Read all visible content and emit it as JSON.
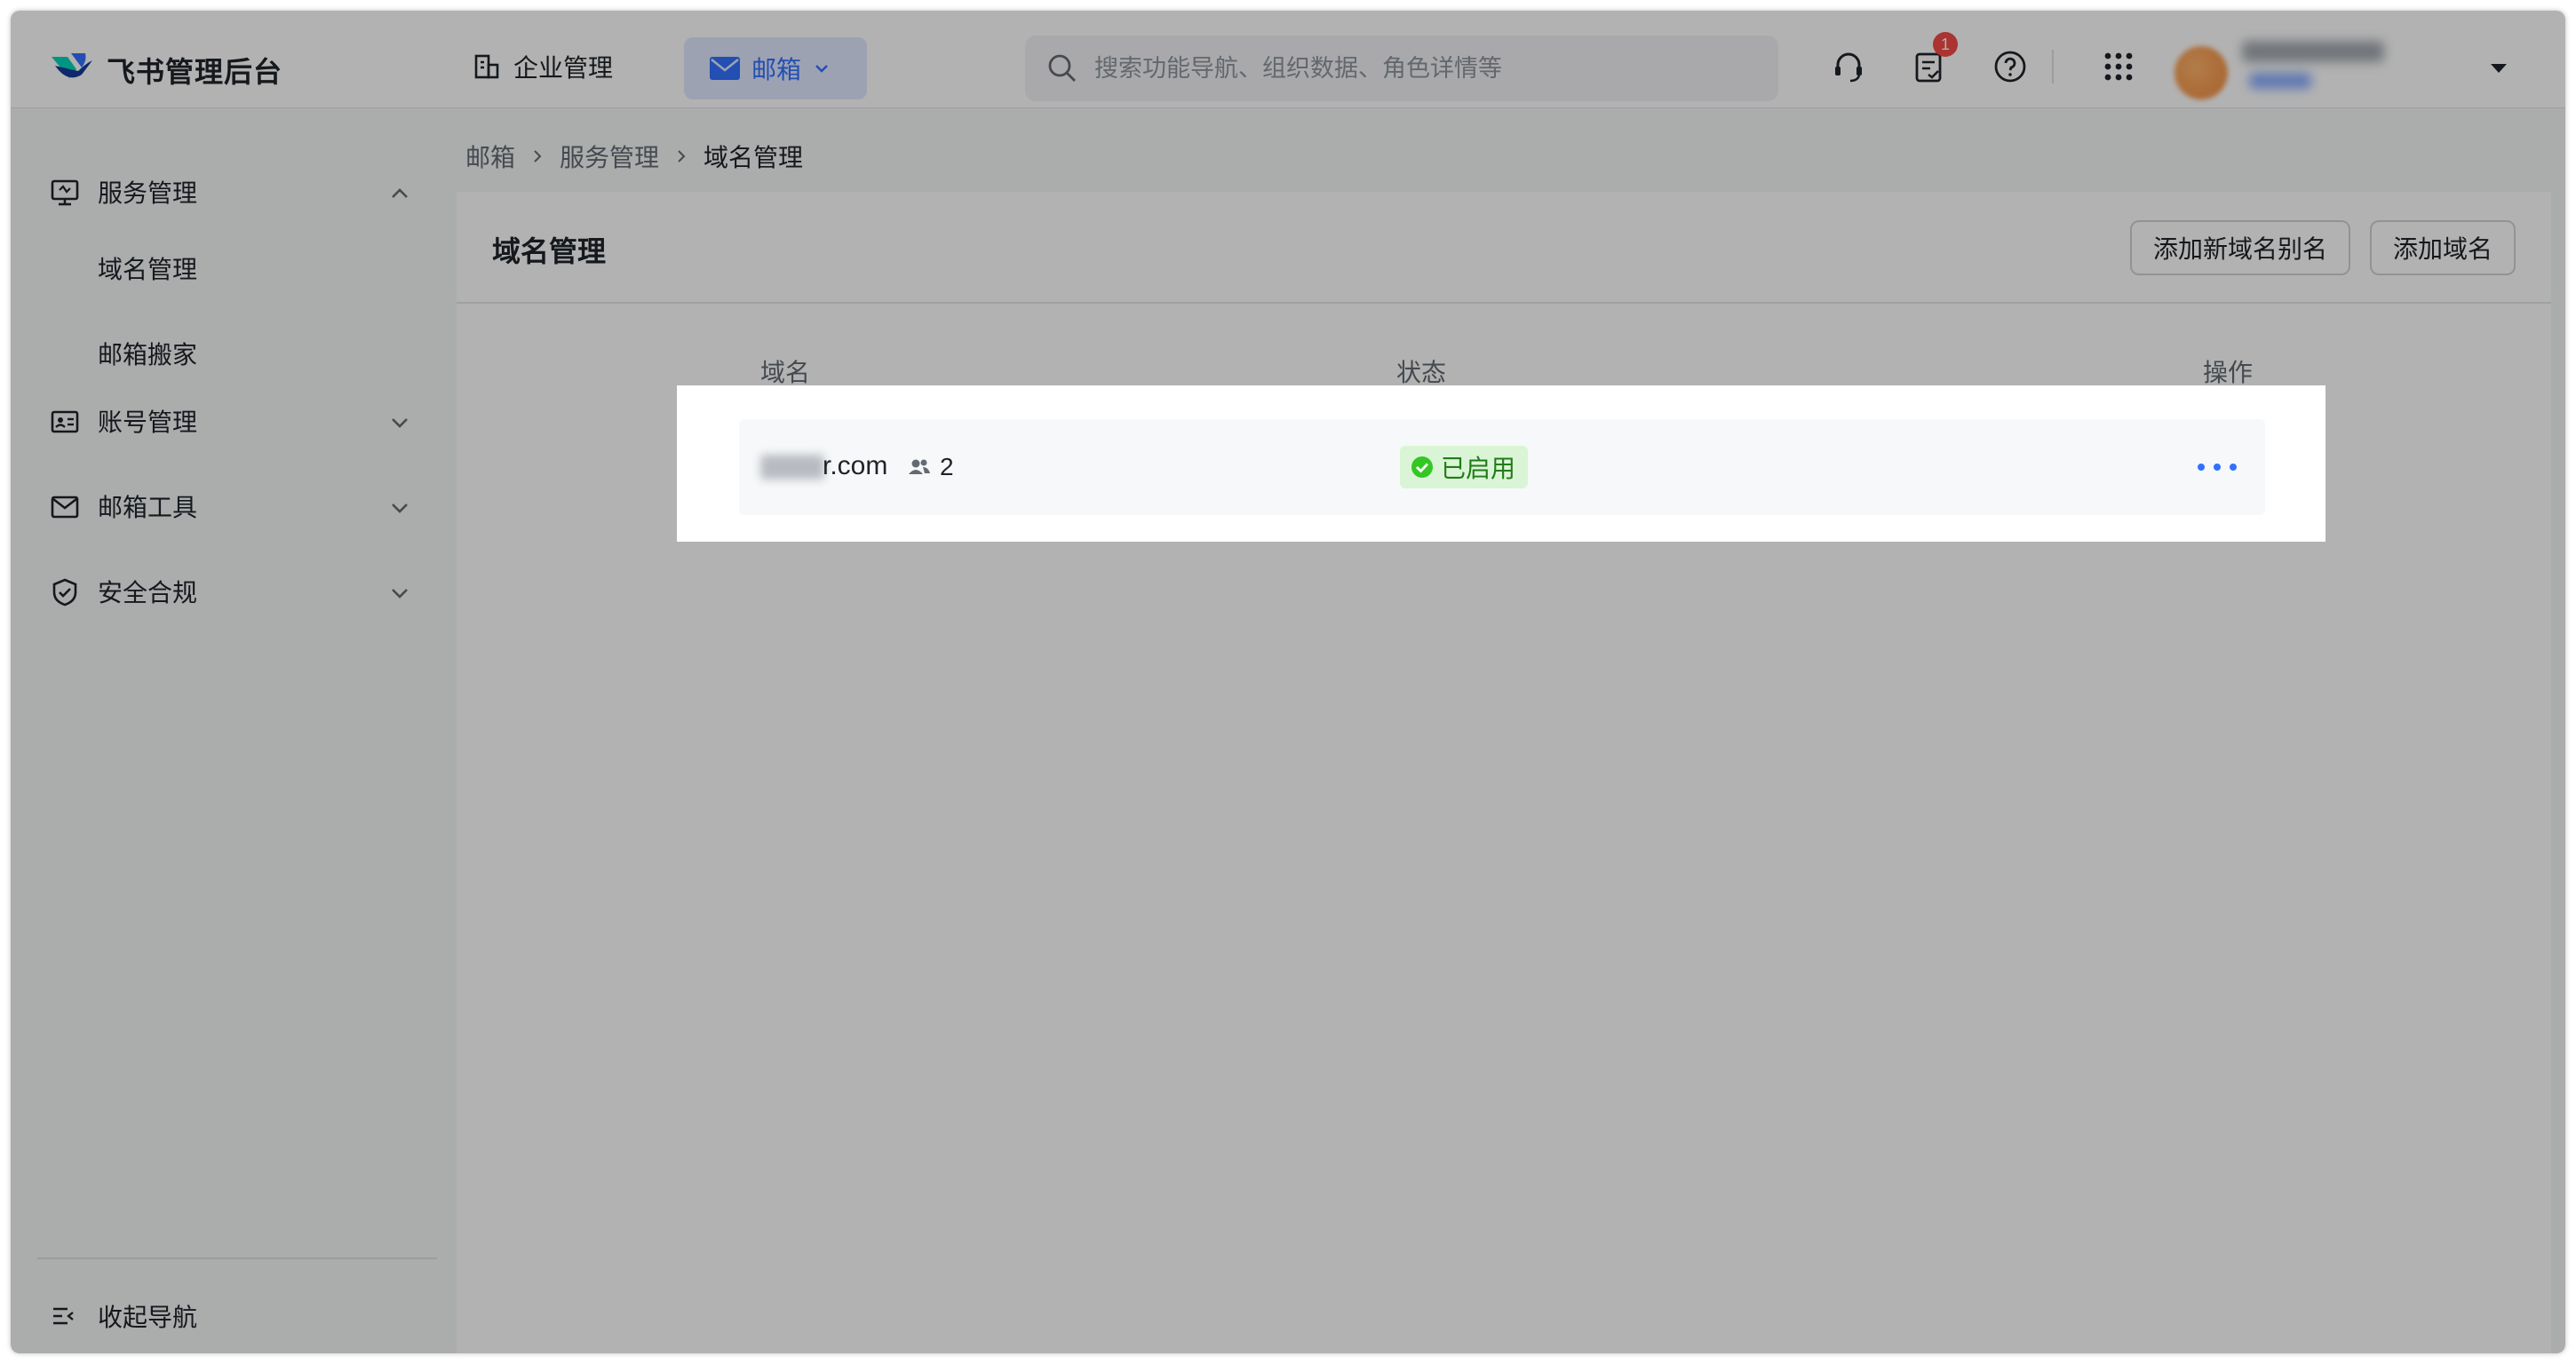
{
  "app": {
    "title": "飞书管理后台"
  },
  "header": {
    "nav_enterprise": "企业管理",
    "nav_mail": "邮箱",
    "search_placeholder": "搜索功能导航、组织数据、角色详情等",
    "notification_count": "1",
    "icons": [
      "headset-icon",
      "task-icon",
      "help-icon",
      "apps-grid-icon",
      "chevron-down-icon"
    ]
  },
  "sidebar": {
    "groups": [
      {
        "label": "服务管理",
        "icon": "monitor-icon",
        "expanded": true,
        "items": [
          "域名管理",
          "邮箱搬家"
        ]
      },
      {
        "label": "账号管理",
        "icon": "id-card-icon",
        "expanded": false
      },
      {
        "label": "邮箱工具",
        "icon": "mail-icon",
        "expanded": false
      },
      {
        "label": "安全合规",
        "icon": "shield-icon",
        "expanded": false
      }
    ],
    "collapse_label": "收起导航"
  },
  "breadcrumb": [
    "邮箱",
    "服务管理",
    "域名管理"
  ],
  "page": {
    "title": "域名管理",
    "add_alias_button": "添加新域名别名",
    "add_domain_button": "添加域名"
  },
  "table": {
    "columns": [
      "域名",
      "状态",
      "操作"
    ],
    "rows": [
      {
        "domain": "r.com",
        "members": "2",
        "status": "已启用"
      }
    ]
  },
  "colors": {
    "accent": "#3370ff",
    "status_bg": "#d9f5d6",
    "status_text": "#237b19",
    "badge": "#f54a45"
  }
}
